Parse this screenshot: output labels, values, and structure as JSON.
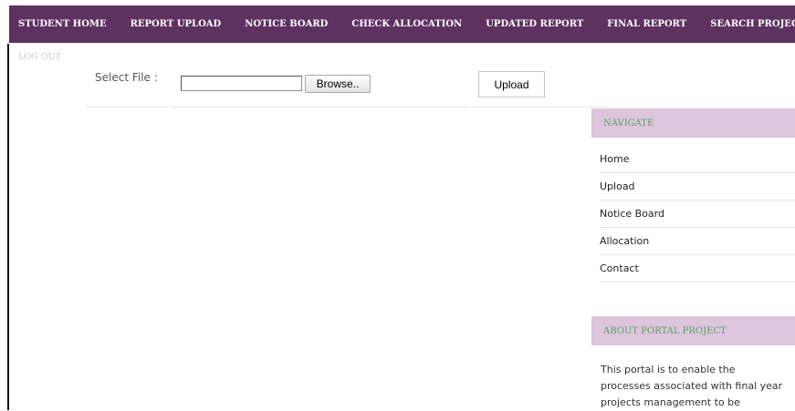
{
  "nav": {
    "items": [
      "STUDENT HOME",
      "REPORT UPLOAD",
      "NOTICE BOARD",
      "CHECK ALLOCATION",
      "UPDATED REPORT",
      "FINAL REPORT",
      "SEARCH PROJECT"
    ],
    "logout": "LOG OUT"
  },
  "form": {
    "select_label": "Select File :",
    "file_value": "",
    "browse_label": "Browse..",
    "upload_label": "Upload"
  },
  "sidebar": {
    "navigate_title": "NAVIGATE",
    "links": [
      "Home",
      "Upload",
      "Notice Board",
      "Allocation",
      "Contact"
    ],
    "about_title": "ABOUT PORTAL PROJECT",
    "about_text": "This portal is to enable the processes associated with final year projects management to be"
  },
  "colors": {
    "nav_background": "#5e3260",
    "sidebar_header": "#ddc5de",
    "sidebar_header_text": "#5aa061"
  }
}
